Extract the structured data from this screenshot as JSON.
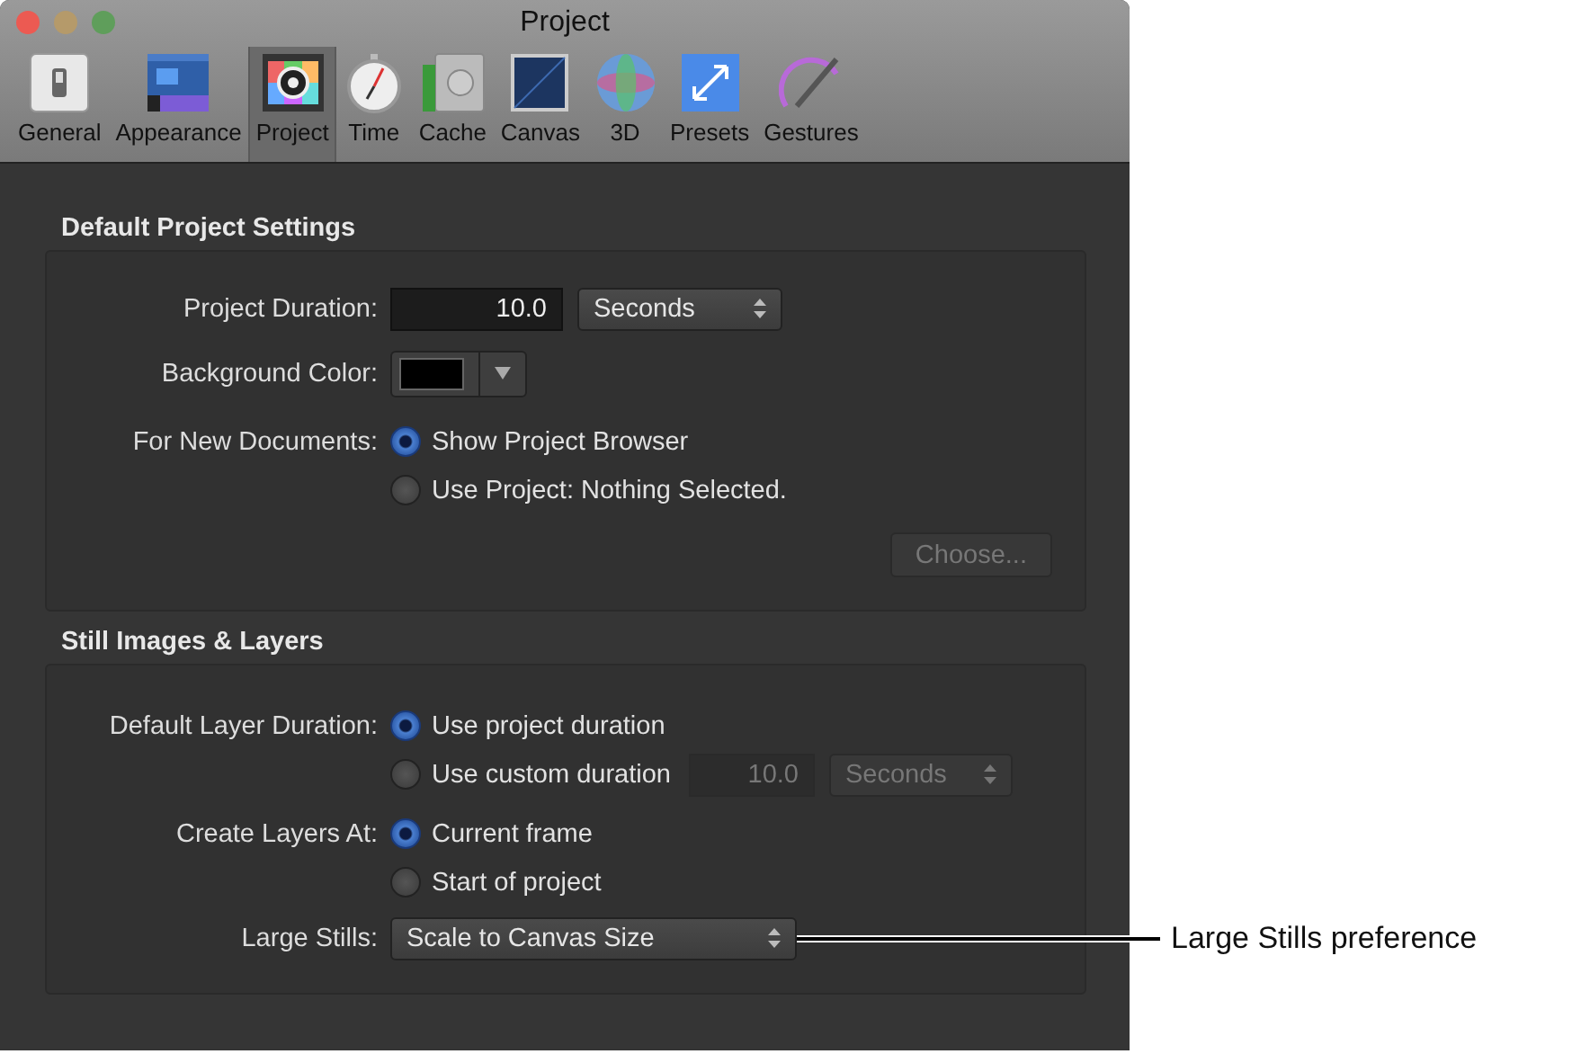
{
  "window": {
    "title": "Project"
  },
  "toolbar": [
    {
      "label": "General",
      "selected": false
    },
    {
      "label": "Appearance",
      "selected": false
    },
    {
      "label": "Project",
      "selected": true
    },
    {
      "label": "Time",
      "selected": false
    },
    {
      "label": "Cache",
      "selected": false
    },
    {
      "label": "Canvas",
      "selected": false
    },
    {
      "label": "3D",
      "selected": false
    },
    {
      "label": "Presets",
      "selected": false
    },
    {
      "label": "Gestures",
      "selected": false
    }
  ],
  "sections": [
    {
      "title": "Default Project Settings",
      "rows": [
        {
          "kind": "duration",
          "label": "Project Duration:",
          "value": "10.0",
          "unit": "Seconds"
        },
        {
          "kind": "color",
          "label": "Background Color:"
        },
        {
          "kind": "radios",
          "label": "For New Documents:",
          "options": [
            {
              "label": "Show Project Browser",
              "selected": true
            },
            {
              "label": "Use Project: Nothing Selected.",
              "selected": false
            }
          ]
        },
        {
          "kind": "button",
          "label": "Choose...",
          "disabled": true
        }
      ]
    },
    {
      "title": "Still Images & Layers",
      "rows": [
        {
          "kind": "radios",
          "label": "Default Layer Duration:",
          "options": [
            {
              "label": "Use project duration",
              "selected": true
            },
            {
              "label": "Use custom duration",
              "selected": false,
              "field": {
                "value": "10.0",
                "unit": "Seconds",
                "disabled": true
              }
            }
          ]
        },
        {
          "kind": "radios",
          "label": "Create Layers At:",
          "options": [
            {
              "label": "Current frame",
              "selected": true
            },
            {
              "label": "Start of project",
              "selected": false
            }
          ]
        },
        {
          "kind": "popup",
          "label": "Large Stills:",
          "value": "Scale to Canvas Size"
        }
      ]
    }
  ],
  "callout": {
    "text": "Large Stills preference"
  }
}
